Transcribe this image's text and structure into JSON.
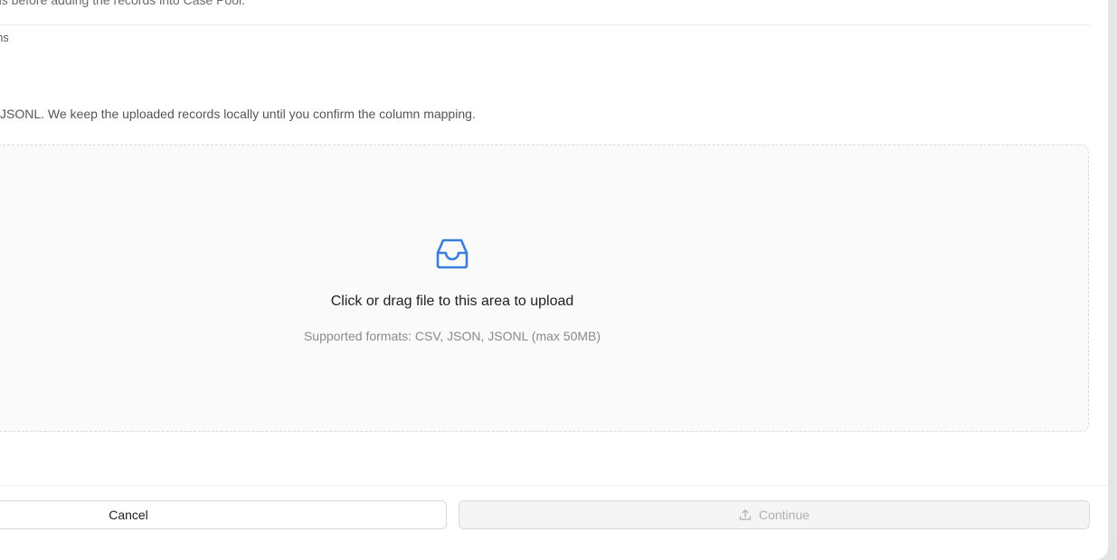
{
  "modal": {
    "description": "ns before adding the records into Case Pool.",
    "step_label": "mns",
    "hint": "JSONL. We keep the uploaded records locally until you confirm the column mapping."
  },
  "dropzone": {
    "icon": "inbox-icon",
    "primary_text": "Click or drag file to this area to upload",
    "secondary_text": "Supported formats: CSV, JSON, JSONL (max 50MB)"
  },
  "footer": {
    "cancel_label": "Cancel",
    "continue_label": "Continue",
    "continue_icon": "upload-icon",
    "continue_disabled": true
  },
  "colors": {
    "accent": "#3b7ddd",
    "disabled_text": "#b0b0b0",
    "dropzone_bg": "#fafafa",
    "border": "#d9d9d9"
  }
}
